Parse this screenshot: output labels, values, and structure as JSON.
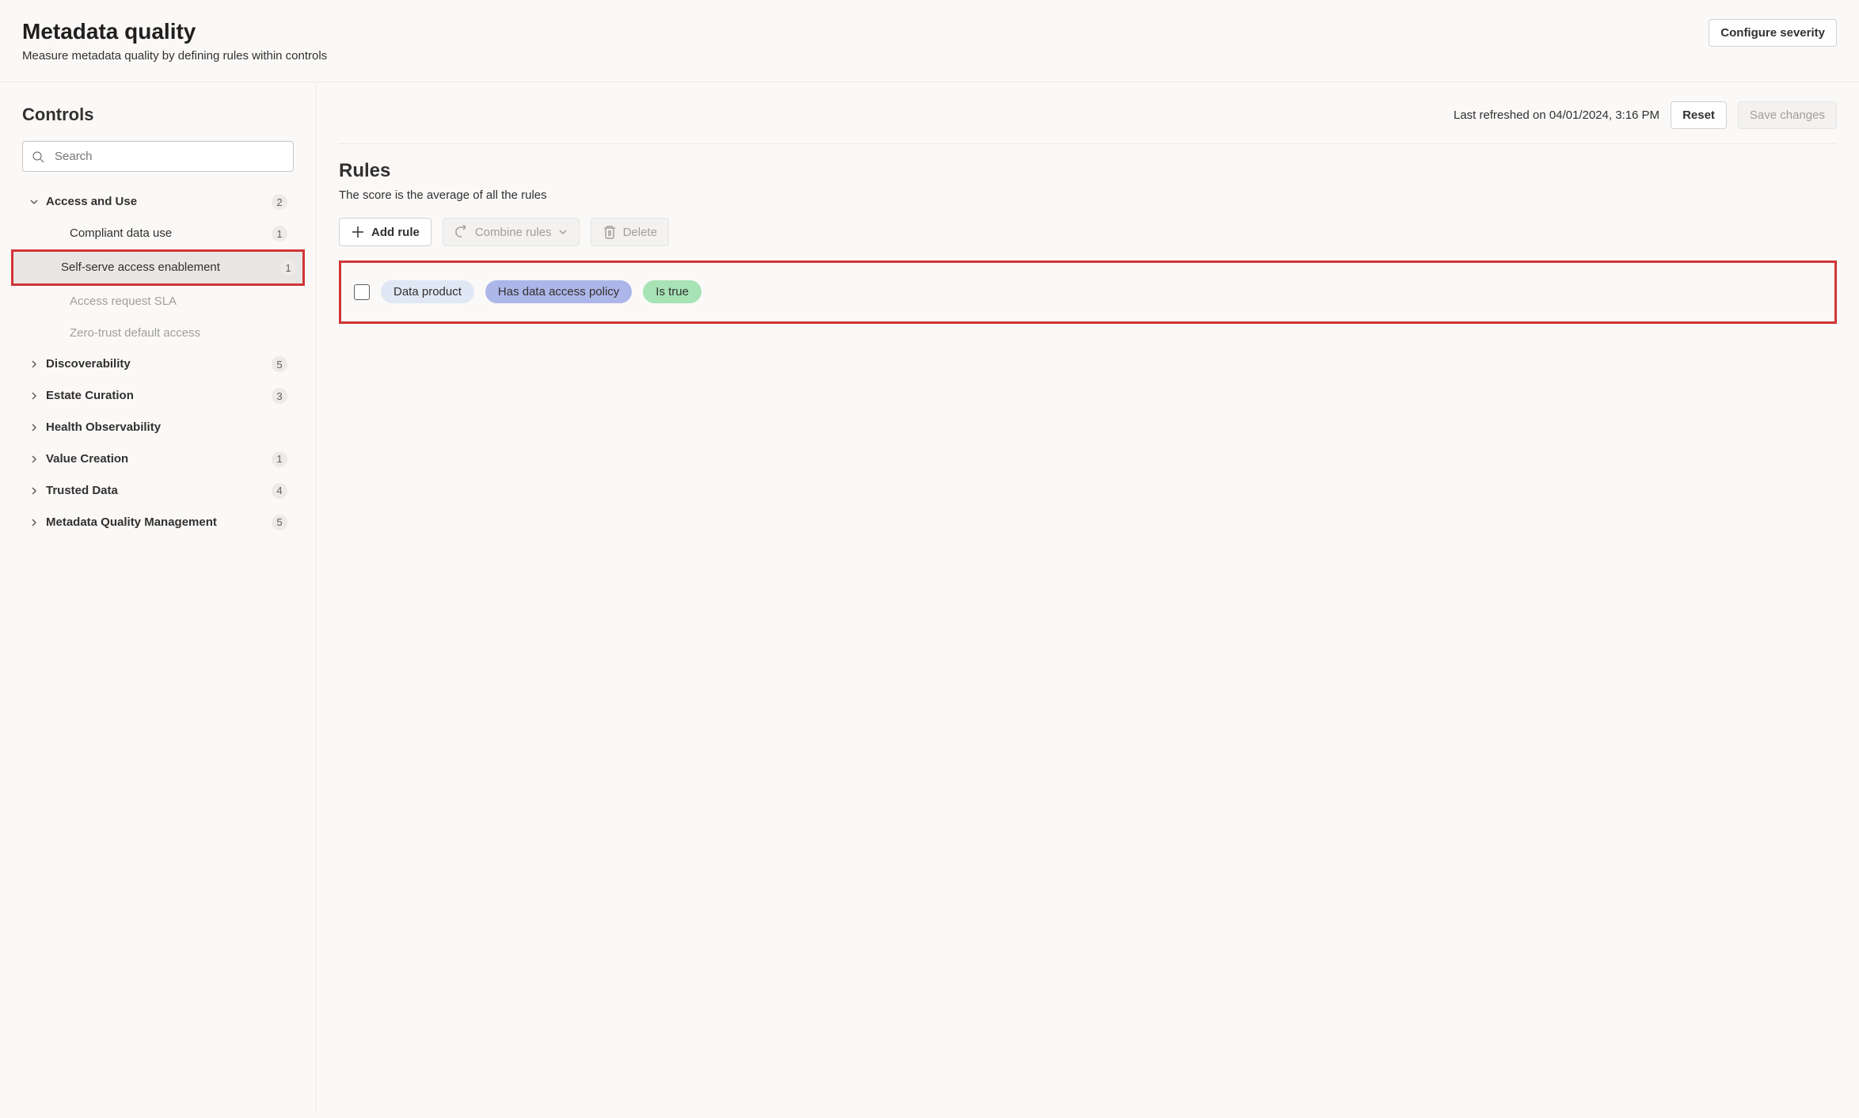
{
  "header": {
    "title": "Metadata quality",
    "subtitle": "Measure metadata quality by defining rules within controls",
    "configure_button": "Configure severity"
  },
  "sidebar": {
    "title": "Controls",
    "search_placeholder": "Search",
    "groups": [
      {
        "label": "Access and Use",
        "count": "2",
        "expanded": true,
        "children": [
          {
            "label": "Compliant data use",
            "count": "1",
            "selected": false,
            "muted": false
          },
          {
            "label": "Self-serve access enablement",
            "count": "1",
            "selected": true,
            "muted": false,
            "highlighted": true
          },
          {
            "label": "Access request SLA",
            "count": "",
            "selected": false,
            "muted": true
          },
          {
            "label": "Zero-trust default access",
            "count": "",
            "selected": false,
            "muted": true
          }
        ]
      },
      {
        "label": "Discoverability",
        "count": "5",
        "expanded": false
      },
      {
        "label": "Estate Curation",
        "count": "3",
        "expanded": false
      },
      {
        "label": "Health Observability",
        "count": "",
        "expanded": false
      },
      {
        "label": "Value Creation",
        "count": "1",
        "expanded": false
      },
      {
        "label": "Trusted Data",
        "count": "4",
        "expanded": false
      },
      {
        "label": "Metadata Quality Management",
        "count": "5",
        "expanded": false
      }
    ]
  },
  "content": {
    "refreshed": "Last refreshed on 04/01/2024, 3:16 PM",
    "reset_button": "Reset",
    "save_button": "Save changes",
    "rules_title": "Rules",
    "rules_subtitle": "The score is the average of all the rules",
    "toolbar": {
      "add_rule": "Add rule",
      "combine_rules": "Combine rules",
      "delete": "Delete"
    },
    "rules": [
      {
        "pills": [
          {
            "text": "Data product",
            "style": "pill-blue-light"
          },
          {
            "text": "Has data access policy",
            "style": "pill-blue"
          },
          {
            "text": "Is true",
            "style": "pill-green"
          }
        ]
      }
    ]
  }
}
